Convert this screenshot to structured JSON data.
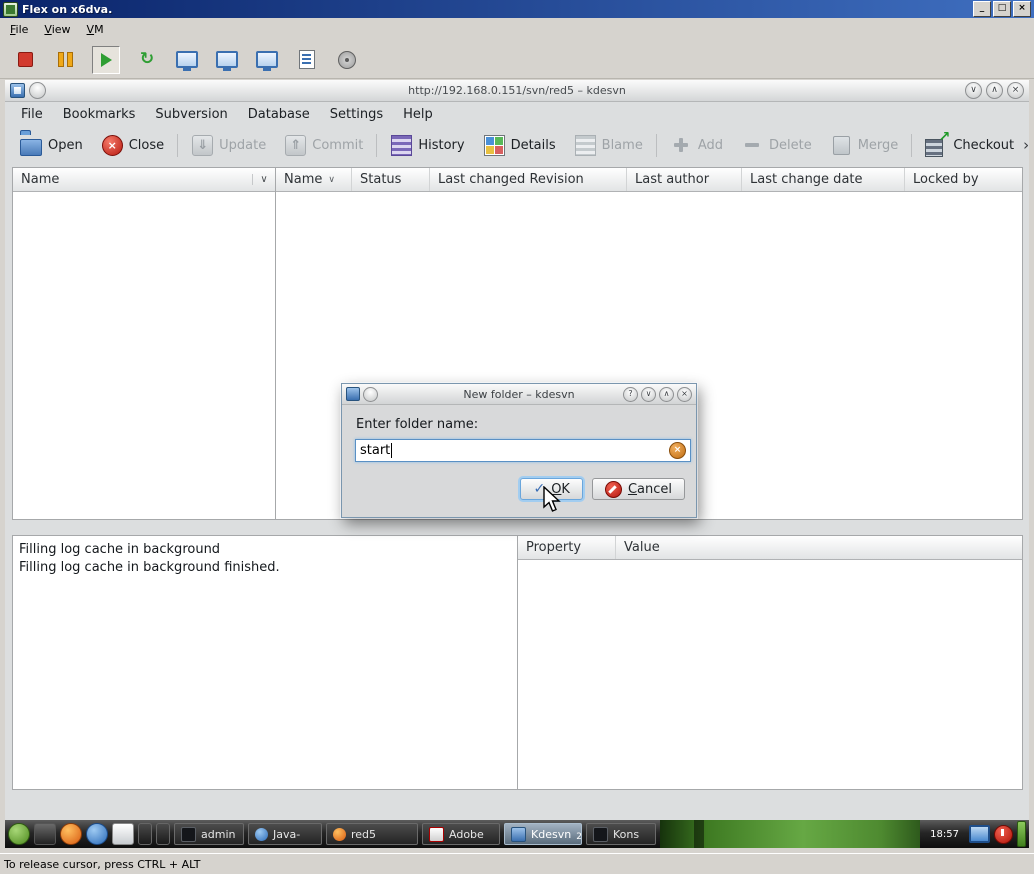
{
  "icons": {
    "minimize": "_",
    "maximize": "□",
    "close": "×",
    "help": "?",
    "chevron_down": "∨",
    "chevron_up": "∧",
    "sort": "∨",
    "overflow": "›",
    "refresh": "↻",
    "update_arrow": "⇓",
    "commit_arrow": "⇑",
    "checkout_arrow": "↗",
    "check": "✓"
  },
  "viewer": {
    "title": "Flex on x6dva.",
    "menu": [
      "File",
      "View",
      "VM"
    ],
    "status": "To release cursor, press CTRL + ALT"
  },
  "kdesvn": {
    "title": "http://192.168.0.151/svn/red5 – kdesvn",
    "menu": [
      "File",
      "Bookmarks",
      "Subversion",
      "Database",
      "Settings",
      "Help"
    ],
    "toolbar": {
      "open": "Open",
      "close": "Close",
      "update": "Update",
      "commit": "Commit",
      "history": "History",
      "details": "Details",
      "blame": "Blame",
      "add": "Add",
      "delete": "Delete",
      "merge": "Merge",
      "checkout": "Checkout"
    },
    "tree_header": "Name",
    "columns": [
      "Name",
      "Status",
      "Last changed Revision",
      "Last author",
      "Last change date",
      "Locked by"
    ],
    "log": [
      "Filling log cache in background",
      "Filling log cache in background finished."
    ],
    "prop_columns": [
      "Property",
      "Value"
    ]
  },
  "dialog": {
    "title": "New folder – kdesvn",
    "prompt": "Enter folder name:",
    "value": "start",
    "ok": "OK",
    "cancel": "Cancel"
  },
  "taskbar": {
    "tasks": [
      {
        "label": "admin"
      },
      {
        "label": "Java-"
      },
      {
        "label": "red5"
      },
      {
        "label": "Adobe"
      },
      {
        "label": "Kdesvn",
        "badge": "2"
      },
      {
        "label": "Kons"
      }
    ],
    "clock": "18:57"
  }
}
